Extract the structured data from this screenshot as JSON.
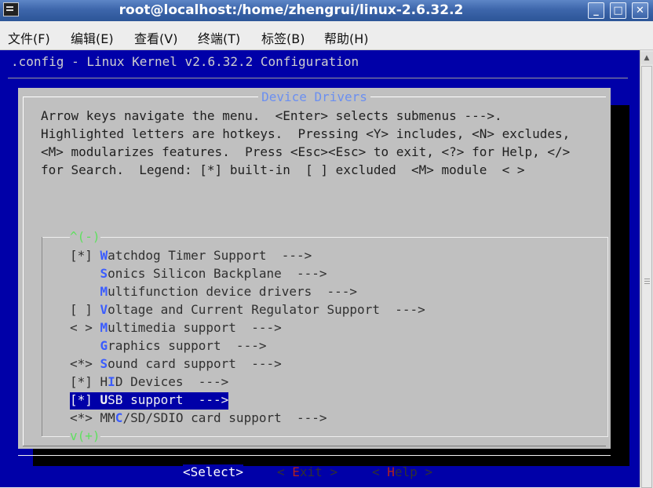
{
  "window": {
    "title": "root@localhost:/home/zhengrui/linux-2.6.32.2",
    "controls": {
      "minimize": "_",
      "maximize": "□",
      "close": "✕"
    }
  },
  "menubar": [
    "文件(F)",
    "编辑(E)",
    "查看(V)",
    "终端(T)",
    "标签(B)",
    "帮助(H)"
  ],
  "terminal": {
    "header": ".config - Linux Kernel v2.6.32.2 Configuration",
    "dialog_title": "Device Drivers",
    "help_lines": [
      "Arrow keys navigate the menu.  <Enter> selects submenus --->.",
      "Highlighted letters are hotkeys.  Pressing <Y> includes, <N> excludes,",
      "<M> modularizes features.  Press <Esc><Esc> to exit, <?> for Help, </>",
      "for Search.  Legend: [*] built-in  [ ] excluded  <M> module  < >"
    ],
    "scroll_up": "^(-)",
    "scroll_down": "v(+)",
    "items": [
      {
        "prefix": "[*] ",
        "hotkey": "W",
        "rest": "atchdog Timer Support  --->"
      },
      {
        "prefix": "    ",
        "hotkey": "S",
        "rest": "onics Silicon Backplane  --->"
      },
      {
        "prefix": "    ",
        "hotkey": "M",
        "rest": "ultifunction device drivers  --->"
      },
      {
        "prefix": "[ ] ",
        "hotkey": "V",
        "rest": "oltage and Current Regulator Support  --->"
      },
      {
        "prefix": "< > ",
        "hotkey": "M",
        "rest": "ultimedia support  --->"
      },
      {
        "prefix": "    ",
        "hotkey": "G",
        "rest": "raphics support  --->"
      },
      {
        "prefix": "<*> ",
        "hotkey": "S",
        "rest": "ound card support  --->"
      },
      {
        "prefix": "[*] ",
        "pre": "H",
        "hotkey": "I",
        "rest": "D Devices  --->"
      },
      {
        "prefix": "[*] ",
        "hotkey": "U",
        "rest": "SB support  --->",
        "selected": true
      },
      {
        "prefix": "<*> ",
        "pre": "MM",
        "hotkey": "C",
        "rest": "/SD/SDIO card support  --->"
      }
    ],
    "buttons": {
      "select": "<Select>",
      "exit_pre": "< ",
      "exit_hotkey": "E",
      "exit_rest": "xit >",
      "help_pre": "< ",
      "help_hotkey": "H",
      "help_rest": "elp >"
    }
  }
}
